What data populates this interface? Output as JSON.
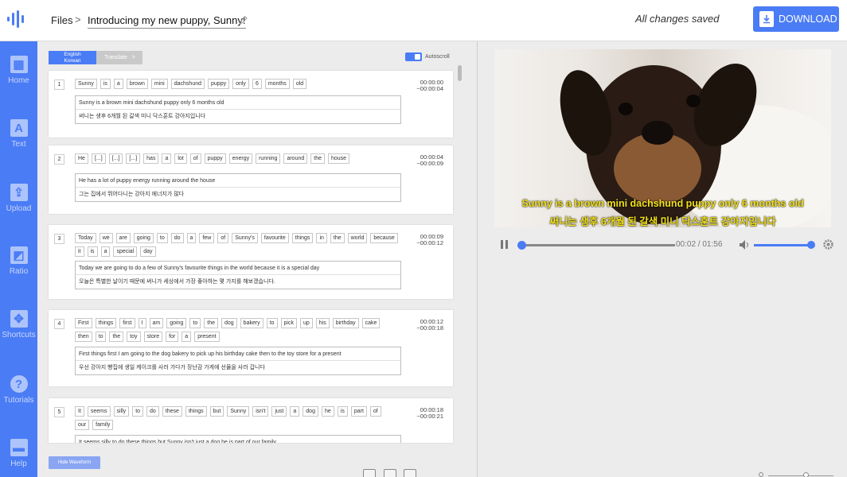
{
  "header": {
    "files": "Files",
    "breadcrumb_sep": ">",
    "project_title": "Introducing my new puppy, Sunny!",
    "save_status": "All changes saved",
    "download": "DOWNLOAD"
  },
  "sidebar": {
    "items": [
      {
        "label": "Home",
        "icon": "home-icon",
        "glyph": "▦"
      },
      {
        "label": "Text",
        "icon": "text-icon",
        "glyph": "A"
      },
      {
        "label": "Upload",
        "icon": "upload-icon",
        "glyph": "⇪"
      },
      {
        "label": "Ratio",
        "icon": "ratio-icon",
        "glyph": "◩"
      },
      {
        "label": "Shortcuts",
        "icon": "shortcuts-icon",
        "glyph": "✥"
      },
      {
        "label": "Tutorials",
        "icon": "tutorials-icon",
        "glyph": "?"
      },
      {
        "label": "Help",
        "icon": "help-icon",
        "glyph": "▬"
      }
    ]
  },
  "editor": {
    "tab_english": "English",
    "tab_korean": "Korean",
    "tab_translate": "Translate",
    "tab_translate_arrow": ">",
    "autoscroll": "Autoscroll",
    "hide_waveform": "Hide Waveform",
    "segments": [
      {
        "num": "1",
        "words": [
          "Sunny",
          "is",
          "a",
          "brown",
          "mini",
          "dachshund",
          "puppy",
          "only",
          "6",
          "months",
          "old"
        ],
        "start": "00:00:00",
        "end": "~00:00:04",
        "english": "Sunny is a brown mini dachshund puppy only 6 months old",
        "korean": "써니는 생후 6개월 된 갈색 미니 닥스훈트 강아지입니다"
      },
      {
        "num": "2",
        "words": [
          "He",
          "[...]",
          "[...]",
          "[...]",
          "has",
          "a",
          "lot",
          "of",
          "puppy",
          "energy",
          "running",
          "around",
          "the",
          "house"
        ],
        "start": "00:00:04",
        "end": "~00:00:09",
        "english": "He has a lot of puppy energy running around the house",
        "korean": "그는 집에서 뛰어다니는 강아지 에너지가 많다"
      },
      {
        "num": "3",
        "words": [
          "Today",
          "we",
          "are",
          "going",
          "to",
          "do",
          "a",
          "few",
          "of",
          "Sunny's",
          "favourite",
          "things",
          "in",
          "the",
          "world",
          "because",
          "it",
          "is",
          "a",
          "special",
          "day"
        ],
        "start": "00:00:09",
        "end": "~00:00:12",
        "english": "Today we are going to do a few of Sunny's favourite things in the world because it is a special day",
        "korean": "오늘은 특별한 날이기 때문에 써니가 세상에서 가장 좋아하는 몇 가지를 해보겠습니다."
      },
      {
        "num": "4",
        "words": [
          "First",
          "things",
          "first",
          "I",
          "am",
          "going",
          "to",
          "the",
          "dog",
          "bakery",
          "to",
          "pick",
          "up",
          "his",
          "birthday",
          "cake",
          "then",
          "to",
          "the",
          "toy",
          "store",
          "for",
          "a",
          "present"
        ],
        "start": "00:00:12",
        "end": "~00:00:18",
        "english": "First things first I am going to the dog bakery to pick up his birthday cake then to the toy store for a present",
        "korean": "우선 강아지 빵집에 생일 케이크를 사러 가다가 장난감 가게에 선물을 사러 갑니다"
      },
      {
        "num": "5",
        "words": [
          "It",
          "seems",
          "silly",
          "to",
          "do",
          "these",
          "things",
          "but",
          "Sunny",
          "isn't",
          "just",
          "a",
          "dog",
          "he",
          "is",
          "part",
          "of",
          "our",
          "family"
        ],
        "start": "00:00:18",
        "end": "~00:00:21",
        "english": "It seems silly to do these things but Sunny isn't just a dog he is part of our family",
        "korean": ""
      }
    ]
  },
  "player": {
    "subtitle_en": "Sunny is a brown mini dachshund puppy only 6 months old",
    "subtitle_ko": "써니는 생후 6개월 된 갈색 미니 닥스훈트 강아지입니다",
    "time": "00:02 / 01:56",
    "progress": 0.017,
    "volume": 1.0
  },
  "colors": {
    "accent": "#4a7cf5",
    "subtitle": "#f4e21a"
  }
}
